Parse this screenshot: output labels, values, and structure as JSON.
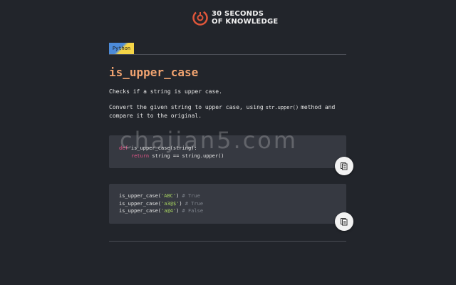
{
  "header": {
    "logo_line1": "30 SECONDS",
    "logo_line2": "OF KNOWLEDGE"
  },
  "tag": {
    "label": "Python"
  },
  "snippet": {
    "title": "is_upper_case",
    "description": "Checks if a string is upper case.",
    "explanation_before": "Convert the given string to upper case, using",
    "explanation_code": "str.upper()",
    "explanation_after": "method and compare it to the original."
  },
  "code": {
    "l1_kw": "def",
    "l1_rest": " is_upper_case(string):",
    "l2_kw": "return",
    "l2_rest": " string == string.upper()"
  },
  "examples": [
    {
      "call_pre": "is_upper_case(",
      "arg": "'ABC'",
      "call_post": ")",
      "comment": " # True"
    },
    {
      "call_pre": "is_upper_case(",
      "arg": "'a3@$'",
      "call_post": ")",
      "comment": " # True"
    },
    {
      "call_pre": "is_upper_case(",
      "arg": "'a@4'",
      "call_post": ")",
      "comment": " # False"
    }
  ],
  "watermark": "chajian5.com",
  "colors": {
    "title": "#f0a370",
    "keyword": "#e6568a",
    "string": "#a6d160",
    "comment": "#7e838c",
    "background": "#22252b",
    "code_bg": "#363941"
  },
  "icons": {
    "logo": "logo-icon",
    "copy": "copy-icon"
  }
}
